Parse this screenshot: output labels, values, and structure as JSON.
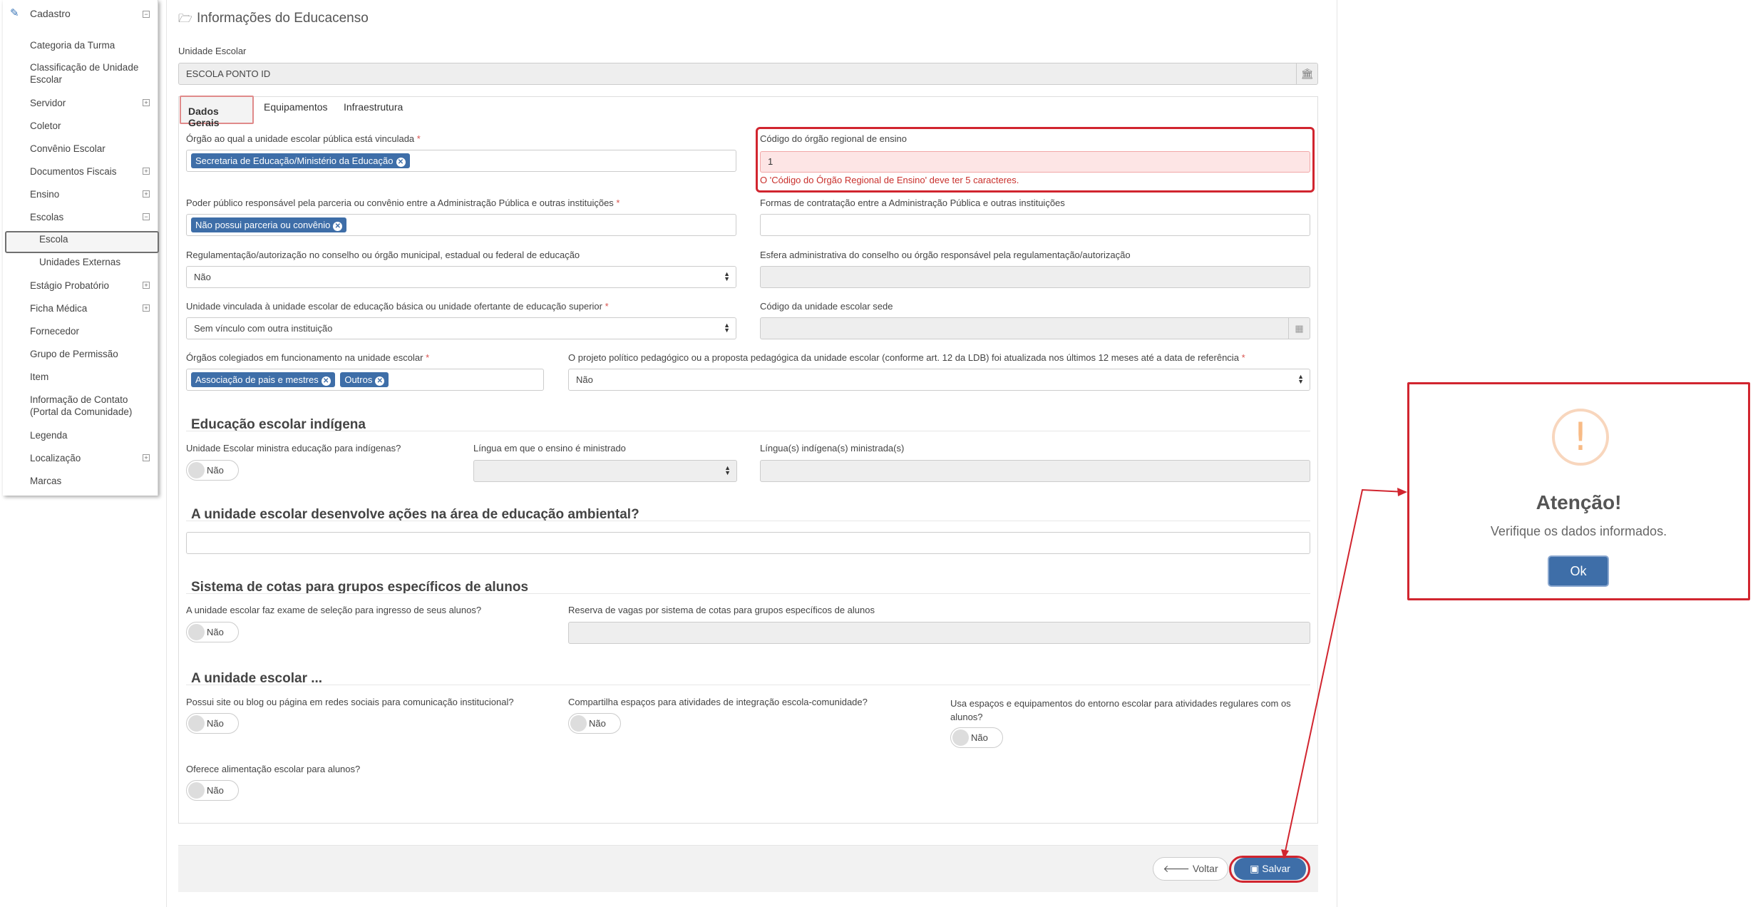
{
  "sidebar": {
    "header": "Cadastro",
    "items": [
      {
        "label": "Categoria da Turma"
      },
      {
        "label": "Classificação de Unidade Escolar"
      },
      {
        "label": "Servidor",
        "expandable": true
      },
      {
        "label": "Coletor"
      },
      {
        "label": "Convênio Escolar"
      },
      {
        "label": "Documentos Fiscais",
        "expandable": true
      },
      {
        "label": "Ensino",
        "expandable": true
      },
      {
        "label": "Escolas",
        "expanded": true
      },
      {
        "label": "Escola",
        "active": true
      },
      {
        "label": "Unidades Externas"
      },
      {
        "label": "Estágio Probatório",
        "expandable": true
      },
      {
        "label": "Ficha Médica",
        "expandable": true
      },
      {
        "label": "Fornecedor"
      },
      {
        "label": "Grupo de Permissão"
      },
      {
        "label": "Item"
      },
      {
        "label": "Informação de Contato (Portal da Comunidade)"
      },
      {
        "label": "Legenda"
      },
      {
        "label": "Localização",
        "expandable": true
      },
      {
        "label": "Marcas"
      }
    ]
  },
  "page": {
    "title": "Informações do Educacenso",
    "unidade_label": "Unidade Escolar",
    "unidade_value": "ESCOLA PONTO ID"
  },
  "tabs": [
    "Dados Gerais",
    "Equipamentos",
    "Infraestrutura"
  ],
  "form": {
    "orgao_label": "Órgão ao qual a unidade escolar pública está vinculada",
    "orgao_tag": "Secretaria de Educação/Ministério da Educação",
    "codigo_label": "Código do órgão regional de ensino",
    "codigo_value": "1",
    "codigo_error": "O 'Código do Órgão Regional de Ensino' deve ter 5 caracteres.",
    "poder_label": "Poder público responsável pela parceria ou convênio entre a Administração Pública e outras instituições",
    "poder_tag": "Não possui parceria ou convênio",
    "formas_label": "Formas de contratação entre a Administração Pública e outras instituições",
    "regul_label": "Regulamentação/autorização no conselho ou órgão municipal, estadual ou federal de educação",
    "regul_value": "Não",
    "esfera_label": "Esfera administrativa do conselho ou órgão responsável pela regulamentação/autorização",
    "vinculo_label": "Unidade vinculada à unidade escolar de educação básica ou unidade ofertante de educação superior",
    "vinculo_value": "Sem vínculo com outra instituição",
    "sede_label": "Código da unidade escolar sede",
    "colegiados_label": "Órgãos colegiados em funcionamento na unidade escolar",
    "colegiados_tags": [
      "Associação de pais e mestres",
      "Outros"
    ],
    "projeto_label": "O projeto político pedagógico ou a proposta pedagógica da unidade escolar (conforme art. 12 da LDB) foi atualizada nos últimos 12 meses até a data de referência",
    "projeto_value": "Não"
  },
  "indigena": {
    "title": "Educação escolar indígena",
    "q1": "Unidade Escolar ministra educação para indígenas?",
    "q1_value": "Não",
    "lingua_label": "Língua em que o ensino é ministrado",
    "linguas_label": "Língua(s) indígena(s) ministrada(s)"
  },
  "ambiental": {
    "title": "A unidade escolar desenvolve ações na área de educação ambiental?"
  },
  "cotas": {
    "title": "Sistema de cotas para grupos específicos de alunos",
    "q1": "A unidade escolar faz exame de seleção para ingresso de seus alunos?",
    "q1_value": "Não",
    "reserva_label": "Reserva de vagas por sistema de cotas para grupos específicos de alunos"
  },
  "unidade": {
    "title": "A unidade escolar ...",
    "q1": "Possui site ou blog ou página em redes sociais para comunicação institucional?",
    "q1_value": "Não",
    "q2": "Compartilha espaços para atividades de integração escola-comunidade?",
    "q2_value": "Não",
    "q3": "Usa espaços e equipamentos do entorno escolar para atividades regulares com os alunos?",
    "q3_value": "Não",
    "q4": "Oferece alimentação escolar para alunos?",
    "q4_value": "Não"
  },
  "footer": {
    "back": "Voltar",
    "save": "Salvar"
  },
  "modal": {
    "icon": "!",
    "title": "Atenção!",
    "text": "Verifique os dados informados.",
    "ok": "Ok"
  },
  "colors": {
    "primary": "#3e6ea8",
    "highlight": "#d1252f",
    "warning": "#f8bb86"
  }
}
